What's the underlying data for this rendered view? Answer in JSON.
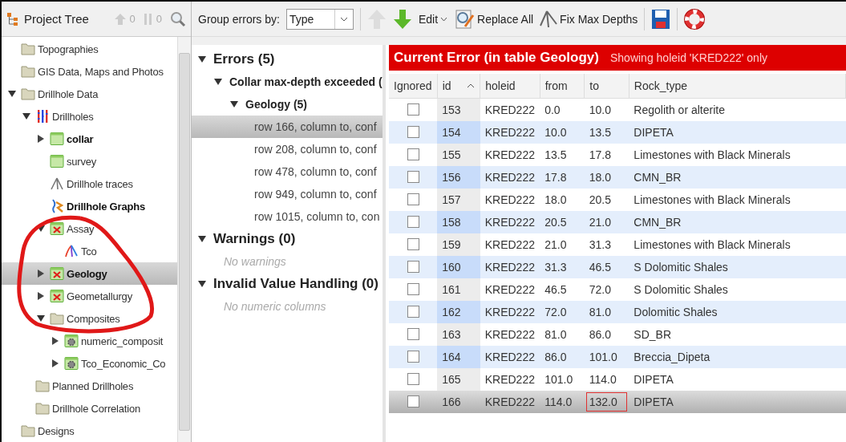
{
  "project_tree": {
    "title": "Project Tree",
    "up_count": "0",
    "bars_count": "0",
    "items": [
      {
        "label": "Topographies",
        "kind": "folder",
        "selected": false,
        "bold": false
      },
      {
        "label": "GIS Data, Maps and Photos",
        "kind": "folder",
        "selected": false,
        "bold": false
      },
      {
        "label": "Drillhole Data",
        "kind": "folder",
        "expanded": true,
        "selected": false,
        "bold": false,
        "children": [
          {
            "label": "Drillholes",
            "kind": "drillholes",
            "expanded": true,
            "selected": false,
            "bold": false,
            "children": [
              {
                "label": "collar",
                "kind": "table",
                "expanded": false,
                "selected": false,
                "bold": true
              },
              {
                "label": "survey",
                "kind": "table",
                "selected": false,
                "bold": false
              },
              {
                "label": "Drillhole traces",
                "kind": "traces",
                "selected": false,
                "bold": false
              },
              {
                "label": "Drillhole Graphs",
                "kind": "graphs",
                "selected": false,
                "bold": true
              },
              {
                "label": "Assay",
                "kind": "table-error",
                "expanded": true,
                "selected": false,
                "bold": false,
                "children": [
                  {
                    "label": "Tco",
                    "kind": "traces-color",
                    "selected": false,
                    "bold": false
                  }
                ]
              },
              {
                "label": "Geology",
                "kind": "table-error",
                "expanded": false,
                "selected": true,
                "bold": true
              },
              {
                "label": "Geometallurgy",
                "kind": "table-error",
                "expanded": false,
                "selected": false,
                "bold": false
              },
              {
                "label": "Composites",
                "kind": "folder",
                "expanded": true,
                "selected": false,
                "bold": false,
                "children": [
                  {
                    "label": "numeric_composit",
                    "kind": "composite",
                    "expanded": false,
                    "selected": false,
                    "bold": false
                  },
                  {
                    "label": "Tco_Economic_Co",
                    "kind": "composite",
                    "expanded": false,
                    "selected": false,
                    "bold": false
                  }
                ]
              }
            ]
          },
          {
            "label": "Planned Drillholes",
            "kind": "folder",
            "selected": false,
            "bold": false
          },
          {
            "label": "Drillhole Correlation",
            "kind": "folder",
            "selected": false,
            "bold": false
          }
        ]
      },
      {
        "label": "Designs",
        "kind": "folder",
        "selected": false,
        "bold": false
      }
    ]
  },
  "toolbar": {
    "group_label": "Group errors by:",
    "group_value": "Type",
    "prev_disabled": true,
    "next_disabled": false,
    "edit": "Edit",
    "replace_all": "Replace All",
    "fix_max_depths": "Fix Max Depths"
  },
  "errors_panel": [
    {
      "label": "Errors (5)",
      "expanded": true,
      "children": [
        {
          "label": "Collar max-depth exceeded (",
          "expanded": true,
          "children": [
            {
              "label": "Geology (5)",
              "expanded": true,
              "items": [
                {
                  "label": "row 166, column to, conf",
                  "selected": true
                },
                {
                  "label": "row 208, column to, conf",
                  "selected": false
                },
                {
                  "label": "row 478, column to, conf",
                  "selected": false
                },
                {
                  "label": "row 949, column to, conf",
                  "selected": false
                },
                {
                  "label": "row 1015, column to, con",
                  "selected": false
                }
              ]
            }
          ]
        }
      ]
    },
    {
      "label": "Warnings (0)",
      "expanded": true,
      "empty_text": "No warnings"
    },
    {
      "label": "Invalid Value Handling (0)",
      "expanded": true,
      "empty_text": "No numeric columns"
    }
  ],
  "current_error": {
    "title": "Current Error (in table Geology)",
    "filter_note": "Showing holeid 'KRED222' only",
    "columns": [
      "Ignored",
      "id",
      "holeid",
      "from",
      "to",
      "Rock_type"
    ],
    "rows": [
      {
        "ignored": false,
        "id": "153",
        "holeid": "KRED222",
        "from": "0.0",
        "to": "10.0",
        "rock_type": "Regolith or alterite",
        "selected": false,
        "to_flagged": false
      },
      {
        "ignored": false,
        "id": "154",
        "holeid": "KRED222",
        "from": "10.0",
        "to": "13.5",
        "rock_type": "DIPETA",
        "selected": false,
        "to_flagged": false
      },
      {
        "ignored": false,
        "id": "155",
        "holeid": "KRED222",
        "from": "13.5",
        "to": "17.8",
        "rock_type": "Limestones with Black Minerals",
        "selected": false,
        "to_flagged": false
      },
      {
        "ignored": false,
        "id": "156",
        "holeid": "KRED222",
        "from": "17.8",
        "to": "18.0",
        "rock_type": "CMN_BR",
        "selected": false,
        "to_flagged": false
      },
      {
        "ignored": false,
        "id": "157",
        "holeid": "KRED222",
        "from": "18.0",
        "to": "20.5",
        "rock_type": "Limestones with Black Minerals",
        "selected": false,
        "to_flagged": false
      },
      {
        "ignored": false,
        "id": "158",
        "holeid": "KRED222",
        "from": "20.5",
        "to": "21.0",
        "rock_type": "CMN_BR",
        "selected": false,
        "to_flagged": false
      },
      {
        "ignored": false,
        "id": "159",
        "holeid": "KRED222",
        "from": "21.0",
        "to": "31.3",
        "rock_type": "Limestones with Black Minerals",
        "selected": false,
        "to_flagged": false
      },
      {
        "ignored": false,
        "id": "160",
        "holeid": "KRED222",
        "from": "31.3",
        "to": "46.5",
        "rock_type": "S Dolomitic Shales",
        "selected": false,
        "to_flagged": false
      },
      {
        "ignored": false,
        "id": "161",
        "holeid": "KRED222",
        "from": "46.5",
        "to": "72.0",
        "rock_type": "S Dolomitic Shales",
        "selected": false,
        "to_flagged": false
      },
      {
        "ignored": false,
        "id": "162",
        "holeid": "KRED222",
        "from": "72.0",
        "to": "81.0",
        "rock_type": "Dolomitic Shales",
        "selected": false,
        "to_flagged": false
      },
      {
        "ignored": false,
        "id": "163",
        "holeid": "KRED222",
        "from": "81.0",
        "to": "86.0",
        "rock_type": "SD_BR",
        "selected": false,
        "to_flagged": false
      },
      {
        "ignored": false,
        "id": "164",
        "holeid": "KRED222",
        "from": "86.0",
        "to": "101.0",
        "rock_type": "Breccia_Dipeta",
        "selected": false,
        "to_flagged": false
      },
      {
        "ignored": false,
        "id": "165",
        "holeid": "KRED222",
        "from": "101.0",
        "to": "114.0",
        "rock_type": "DIPETA",
        "selected": false,
        "to_flagged": false
      },
      {
        "ignored": false,
        "id": "166",
        "holeid": "KRED222",
        "from": "114.0",
        "to": "132.0",
        "rock_type": "DIPETA",
        "selected": true,
        "to_flagged": true
      }
    ]
  }
}
